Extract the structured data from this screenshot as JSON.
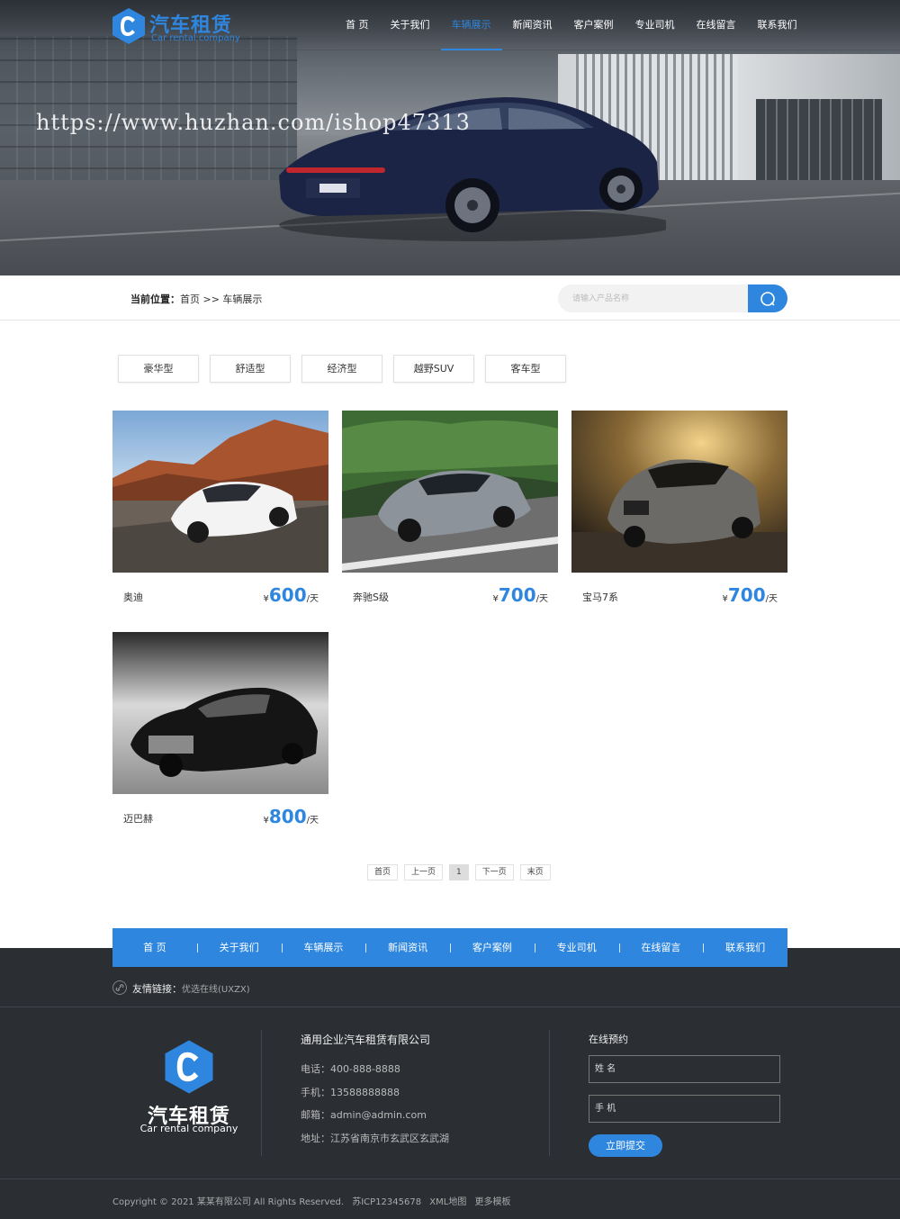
{
  "brand": {
    "name_cn": "汽车租赁",
    "name_en": "Car rental company"
  },
  "nav": [
    "首 页",
    "关于我们",
    "车辆展示",
    "新闻资讯",
    "客户案例",
    "专业司机",
    "在线留言",
    "联系我们"
  ],
  "nav_active": "车辆展示",
  "watermark": "https://www.huzhan.com/ishop47313",
  "breadcrumb": {
    "label": "当前位置：",
    "path": "首页 >> 车辆展示"
  },
  "search": {
    "placeholder": "请输入产品名称"
  },
  "categories": [
    "豪华型",
    "舒适型",
    "经济型",
    "越野SUV",
    "客车型"
  ],
  "products": [
    {
      "name": "奥迪",
      "currency": "¥",
      "price": "600",
      "unit": "/天"
    },
    {
      "name": "奔驰S级",
      "currency": "¥",
      "price": "700",
      "unit": "/天"
    },
    {
      "name": "宝马7系",
      "currency": "¥",
      "price": "700",
      "unit": "/天"
    },
    {
      "name": "迈巴赫",
      "currency": "¥",
      "price": "800",
      "unit": "/天"
    }
  ],
  "pagination": [
    "首页",
    "上一页",
    "1",
    "下一页",
    "末页"
  ],
  "footer_nav": [
    "首 页",
    "关于我们",
    "车辆展示",
    "新闻资讯",
    "客户案例",
    "专业司机",
    "在线留言",
    "联系我们"
  ],
  "friend_links": {
    "label": "友情链接：",
    "items": [
      "优选在线(UXZX)"
    ]
  },
  "contact": {
    "company": "通用企业汽车租赁有限公司",
    "phone": "电话：400-888-8888",
    "mobile": "手机：13588888888",
    "email": "邮箱：admin@admin.com",
    "address": "地址：江苏省南京市玄武区玄武湖"
  },
  "booking": {
    "title": "在线预约",
    "name_placeholder": "姓 名",
    "phone_placeholder": "手 机",
    "submit": "立即提交"
  },
  "copyright": {
    "text": "Copyright © 2021 某某有限公司 All Rights Reserved.",
    "icp": "苏ICP12345678",
    "sitemap": "XML地图",
    "more": "更多模板"
  },
  "colors": {
    "accent": "#2e86de",
    "footer_bg": "#2b2e33"
  }
}
